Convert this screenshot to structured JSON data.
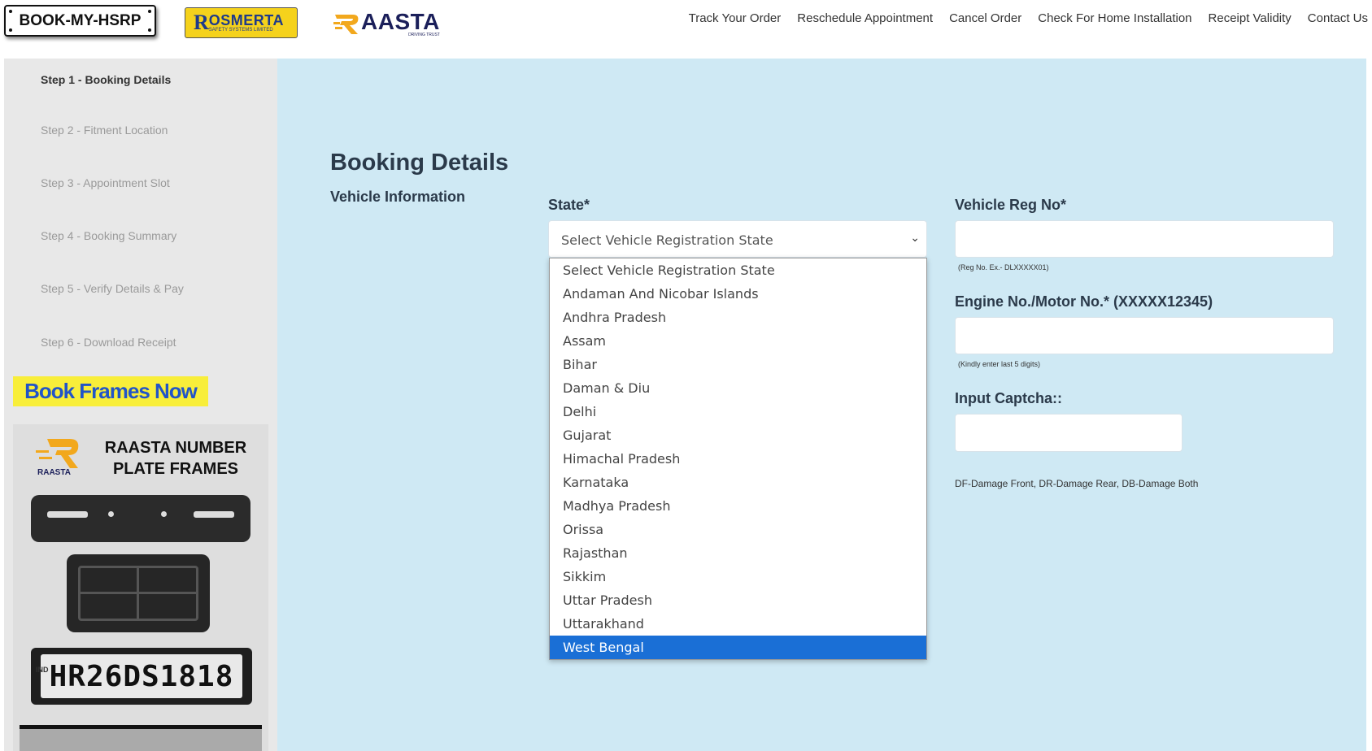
{
  "header": {
    "logo_hsrp": "BOOK-MY-HSRP",
    "logo_rosmerta": "OSMERTA",
    "logo_rosmerta_r": "R",
    "logo_rosmerta_sub": "SAFETY SYSTEMS LIMITED",
    "logo_raasta": "AASTA",
    "logo_raasta_sub": "DRIVING TRUST",
    "nav": [
      "Track Your Order",
      "Reschedule Appointment",
      "Cancel Order",
      "Check For Home Installation",
      "Receipt Validity",
      "Contact Us"
    ]
  },
  "sidebar": {
    "steps": [
      "Step 1 - Booking Details",
      "Step 2 - Fitment Location",
      "Step 3 - Appointment Slot",
      "Step 4 - Booking Summary",
      "Step 5 - Verify Details & Pay",
      "Step 6 - Download Receipt"
    ],
    "active_step": 0,
    "book_frames_label": "Book Frames Now",
    "ad_title": "RAASTA NUMBER PLATE FRAMES",
    "ad_logo_text": "RAASTA",
    "plate_text": "HR26DS1818",
    "plate_country": "IND"
  },
  "main": {
    "title": "Booking Details",
    "section": "Vehicle Information",
    "state_label": "State*",
    "state_value": "Select Vehicle Registration State",
    "reg_label": "Vehicle Reg No*",
    "reg_help": "(Reg No. Ex.- DLXXXXX01)",
    "engine_label": "Engine No./Motor No.* (XXXXX12345)",
    "engine_help": "(Kindly enter last 5 digits)",
    "captcha_label": "Input Captcha::",
    "damage_note": "DF-Damage Front, DR-Damage Rear, DB-Damage Both"
  },
  "dropdown": {
    "options": [
      "Select Vehicle Registration State",
      "Andaman And Nicobar Islands",
      "Andhra Pradesh",
      "Assam",
      "Bihar",
      "Daman & Diu",
      "Delhi",
      "Gujarat",
      "Himachal Pradesh",
      "Karnataka",
      "Madhya Pradesh",
      "Orissa",
      "Rajasthan",
      "Sikkim",
      "Uttar Pradesh",
      "Uttarakhand",
      "West Bengal"
    ],
    "highlighted_index": 16
  },
  "colors": {
    "main_bg": "#cfe9f4",
    "sidebar_bg": "#e8e8e8",
    "highlight": "#1a6fd6",
    "book_btn_bg": "#f8ee3a",
    "book_btn_text": "#2154c8"
  }
}
